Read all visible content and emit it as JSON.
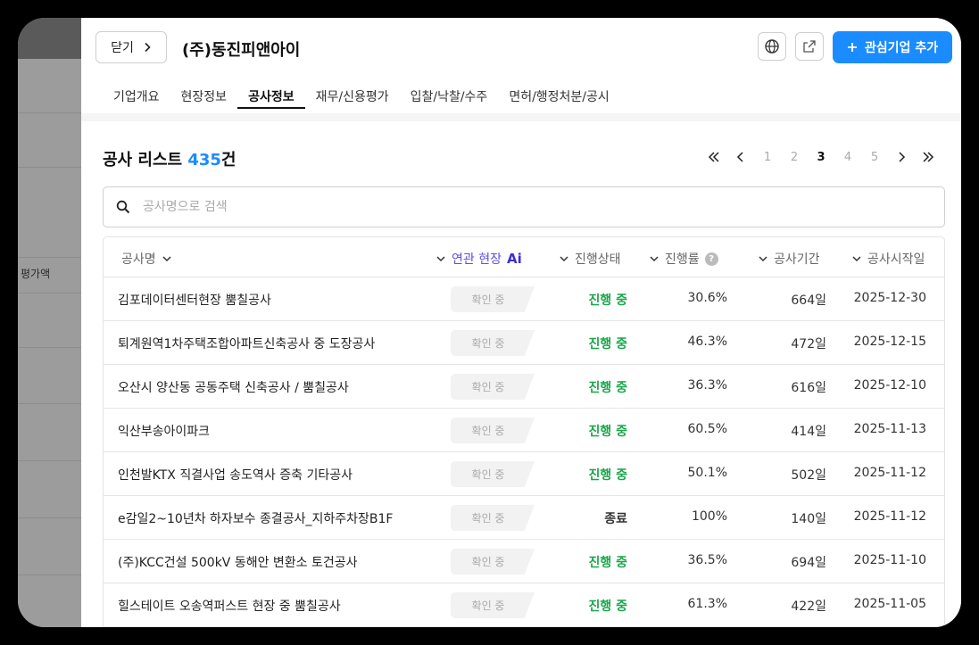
{
  "background": {
    "side_label": "평가액"
  },
  "header": {
    "close_label": "닫기",
    "company_name": "(주)동진피앤아이",
    "add_label": "관심기업 추가"
  },
  "tabs": [
    {
      "label": "기업개요",
      "active": false
    },
    {
      "label": "현장정보",
      "active": false
    },
    {
      "label": "공사정보",
      "active": true
    },
    {
      "label": "재무/신용평가",
      "active": false
    },
    {
      "label": "입찰/낙찰/수주",
      "active": false
    },
    {
      "label": "면허/행정처분/공시",
      "active": false
    }
  ],
  "list": {
    "title_prefix": "공사 리스트 ",
    "count": "435",
    "count_suffix": "건"
  },
  "pagination": {
    "pages": [
      "1",
      "2",
      "3",
      "4",
      "5"
    ],
    "current": "3"
  },
  "search": {
    "placeholder": "공사명으로 검색"
  },
  "table": {
    "headers": {
      "name": "공사명",
      "related": "연관 현장",
      "related_ai": "Ai",
      "status": "진행상태",
      "rate": "진행률",
      "period": "공사기간",
      "start": "공사시작일"
    },
    "rows": [
      {
        "name": "김포데이터센터현장 뿜칠공사",
        "badge": "확인 중",
        "status": "진행 중",
        "status_color": "green",
        "rate": "30.6%",
        "days": "664일",
        "date": "2025-12-30"
      },
      {
        "name": "퇴계원역1차주택조합아파트신축공사 중 도장공사",
        "badge": "확인 중",
        "status": "진행 중",
        "status_color": "green",
        "rate": "46.3%",
        "days": "472일",
        "date": "2025-12-15"
      },
      {
        "name": "오산시 양산동 공동주택 신축공사 / 뿜칠공사",
        "badge": "확인 중",
        "status": "진행 중",
        "status_color": "green",
        "rate": "36.3%",
        "days": "616일",
        "date": "2025-12-10"
      },
      {
        "name": "익산부송아이파크",
        "badge": "확인 중",
        "status": "진행 중",
        "status_color": "green",
        "rate": "60.5%",
        "days": "414일",
        "date": "2025-11-13"
      },
      {
        "name": "인천발KTX 직결사업 송도역사 증축 기타공사",
        "badge": "확인 중",
        "status": "진행 중",
        "status_color": "green",
        "rate": "50.1%",
        "days": "502일",
        "date": "2025-11-12"
      },
      {
        "name": "e감일2~10년차 하자보수 종결공사_지하주차장B1F",
        "badge": "확인 중",
        "status": "종료",
        "status_color": "dark",
        "rate": "100%",
        "days": "140일",
        "date": "2025-11-12"
      },
      {
        "name": "(주)KCC건설 500kV 동해안 변환소 토건공사",
        "badge": "확인 중",
        "status": "진행 중",
        "status_color": "green",
        "rate": "36.5%",
        "days": "694일",
        "date": "2025-11-10"
      },
      {
        "name": "힐스테이트 오송역퍼스트 현장 중 뿜칠공사",
        "badge": "확인 중",
        "status": "진행 중",
        "status_color": "green",
        "rate": "61.3%",
        "days": "422일",
        "date": "2025-11-05"
      }
    ]
  }
}
